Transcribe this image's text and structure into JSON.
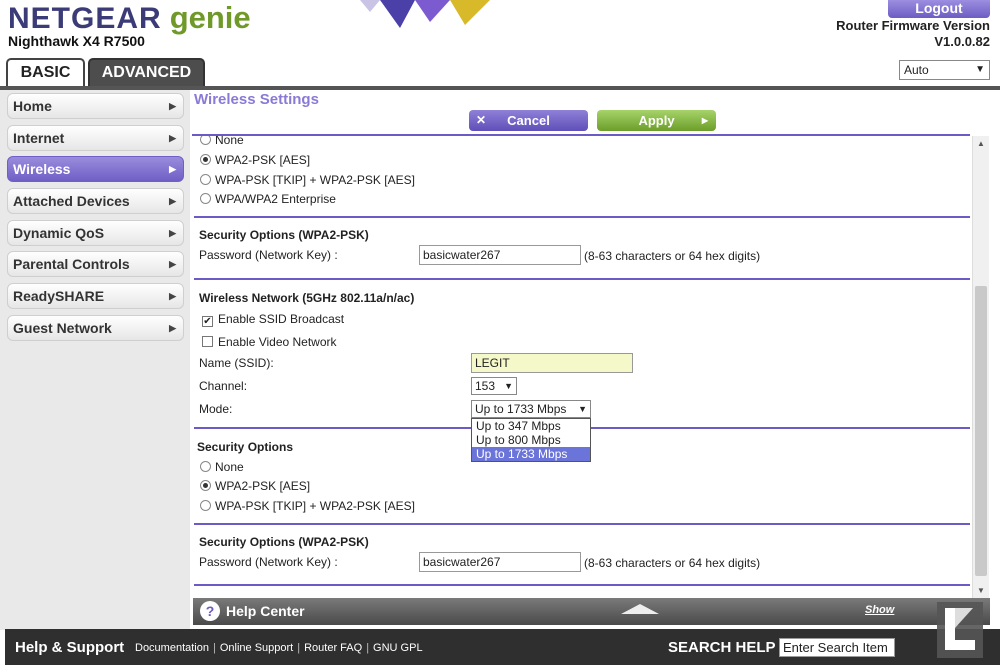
{
  "header": {
    "brand": "NETGEAR",
    "brand_suffix": "genie",
    "model": "Nighthawk X4 R7500",
    "logout_label": "Logout",
    "firmware_label": "Router Firmware Version",
    "firmware_version": "V1.0.0.82",
    "tabs": [
      {
        "label": "BASIC",
        "active": true
      },
      {
        "label": "ADVANCED",
        "active": false
      }
    ],
    "language_select": "Auto"
  },
  "sidebar": {
    "items": [
      {
        "label": "Home",
        "active": false
      },
      {
        "label": "Internet",
        "active": false
      },
      {
        "label": "Wireless",
        "active": true
      },
      {
        "label": "Attached Devices",
        "active": false
      },
      {
        "label": "Dynamic QoS",
        "active": false
      },
      {
        "label": "Parental Controls",
        "active": false
      },
      {
        "label": "ReadySHARE",
        "active": false
      },
      {
        "label": "Guest Network",
        "active": false
      }
    ]
  },
  "main": {
    "title": "Wireless Settings",
    "cancel_label": "Cancel",
    "apply_label": "Apply",
    "band24_security": {
      "opt_none": "None",
      "opt_wpa2": "WPA2-PSK [AES]",
      "opt_mixed": "WPA-PSK [TKIP] + WPA2-PSK [AES]",
      "opt_enterprise": "WPA/WPA2 Enterprise",
      "selected": "WPA2-PSK [AES]"
    },
    "band24_key": {
      "heading": "Security Options (WPA2-PSK)",
      "label": "Password (Network Key) :",
      "value": "basicwater267",
      "hint": "(8-63 characters or 64 hex digits)"
    },
    "band5": {
      "heading": "Wireless Network (5GHz 802.11a/n/ac)",
      "enable_ssid_broadcast": "Enable SSID Broadcast",
      "ssid_broadcast_checked": true,
      "enable_video_network": "Enable Video Network",
      "video_network_checked": false,
      "name_label": "Name (SSID):",
      "name_value": "LEGIT",
      "channel_label": "Channel:",
      "channel_value": "153",
      "mode_label": "Mode:",
      "mode_value": "Up to 1733 Mbps",
      "mode_options": [
        "Up to 347 Mbps",
        "Up to 800 Mbps",
        "Up to 1733 Mbps"
      ]
    },
    "band5_security": {
      "heading": "Security Options",
      "opt_none": "None",
      "opt_wpa2": "WPA2-PSK [AES]",
      "opt_mixed": "WPA-PSK [TKIP] + WPA2-PSK [AES]",
      "selected": "WPA2-PSK [AES]"
    },
    "band5_key": {
      "heading": "Security Options (WPA2-PSK)",
      "label": "Password (Network Key) :",
      "value": "basicwater267",
      "hint": "(8-63 characters or 64 hex digits)"
    }
  },
  "help": {
    "title": "Help Center",
    "show_label": "Show"
  },
  "footer": {
    "title": "Help & Support",
    "links": [
      "Documentation",
      "Online Support",
      "Router FAQ",
      "GNU GPL"
    ],
    "search_label": "SEARCH HELP",
    "search_placeholder": "Enter Search Item"
  },
  "colors": {
    "accent_purple": "#6a5cc4",
    "apply_green": "#6c9e2a",
    "brand_navy": "#3b3b78",
    "genie_green": "#6f9a2a"
  }
}
